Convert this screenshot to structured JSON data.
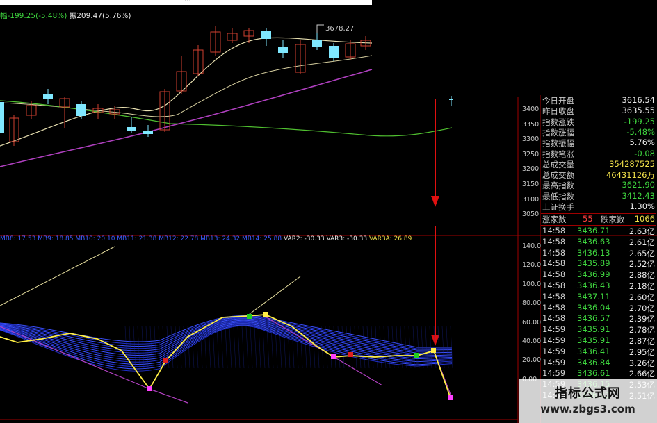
{
  "top_title": "...",
  "info": {
    "change_label": "幅",
    "change_text": "-199.25(-5.48%)",
    "amp_label": "振",
    "amp_text": "209.47(5.76%)"
  },
  "peak_label": "3678.27",
  "price_axis": [
    "3400",
    "3350",
    "3300",
    "3250",
    "3200",
    "3150",
    "3100",
    "3050"
  ],
  "indicator_axis": [
    "140.0",
    "120.0",
    "100.0",
    "80.00",
    "60.00",
    "40.00",
    "20.00",
    "0.00"
  ],
  "indicator_line": {
    "blue_text": "MB8: 17.53  MB9: 18.85  MB10: 20.10  MB11: 21.38  MB12: 22.78  MB13: 24.32  MB14: 25.88",
    "var2": "VAR2: -30.33",
    "var3": "VAR3: -30.33",
    "var3a": "VAR3A: 26.89"
  },
  "summary": [
    {
      "label": "今日开盘",
      "value": "3616.54",
      "color": "#e8e8e8"
    },
    {
      "label": "昨日收盘",
      "value": "3635.55",
      "color": "#e8e8e8"
    },
    {
      "label": "指数涨跌",
      "value": "-199.25",
      "color": "#3fd63f"
    },
    {
      "label": "指数涨幅",
      "value": "-5.48%",
      "color": "#3fd63f"
    },
    {
      "label": "指数振幅",
      "value": "5.76%",
      "color": "#e8e8e8"
    },
    {
      "label": "指数笔涨",
      "value": "-0.08",
      "color": "#3fd63f"
    },
    {
      "label": "总成交量",
      "value": "354287525",
      "color": "#f2e14a"
    },
    {
      "label": "总成交额",
      "value": "46431126万",
      "color": "#f2e14a"
    },
    {
      "label": "最高指数",
      "value": "3621.90",
      "color": "#3fd63f"
    },
    {
      "label": "最低指数",
      "value": "3412.43",
      "color": "#3fd63f"
    },
    {
      "label": "上证换手",
      "value": "1.30%",
      "color": "#e8e8e8"
    }
  ],
  "breadth": {
    "up_label": "涨家数",
    "up_value": "55",
    "down_label": "跌家数",
    "down_value": "1066"
  },
  "ticks": [
    {
      "time": "14:58",
      "price": "3436.71",
      "amount": "2.63亿"
    },
    {
      "time": "14:58",
      "price": "3436.63",
      "amount": "2.61亿"
    },
    {
      "time": "14:58",
      "price": "3436.13",
      "amount": "2.65亿"
    },
    {
      "time": "14:58",
      "price": "3435.89",
      "amount": "2.52亿"
    },
    {
      "time": "14:58",
      "price": "3436.99",
      "amount": "2.88亿"
    },
    {
      "time": "14:58",
      "price": "3436.43",
      "amount": "2.18亿"
    },
    {
      "time": "14:58",
      "price": "3437.11",
      "amount": "2.60亿"
    },
    {
      "time": "14:58",
      "price": "3436.04",
      "amount": "2.70亿"
    },
    {
      "time": "14:58",
      "price": "3436.57",
      "amount": "2.39亿"
    },
    {
      "time": "14:59",
      "price": "3435.91",
      "amount": "2.78亿"
    },
    {
      "time": "14:59",
      "price": "3435.91",
      "amount": "2.87亿"
    },
    {
      "time": "14:59",
      "price": "3436.41",
      "amount": "2.95亿"
    },
    {
      "time": "14:59",
      "price": "3436.84",
      "amount": "3.26亿"
    },
    {
      "time": "14:59",
      "price": "3436.61",
      "amount": "2.66亿"
    },
    {
      "time": "14:59",
      "price": "3436.15",
      "amount": "2.53亿"
    },
    {
      "time": "14:59",
      "price": "3436.43",
      "amount": "2.51亿"
    }
  ],
  "watermark": {
    "title": "指标公式网",
    "url": "www.zbgs3.com"
  },
  "colors": {
    "up": "#d04030",
    "down": "#7fe8ff",
    "ma_short": "#e8e0b0",
    "ma_mid": "#50c030",
    "ma_long": "#b040c0",
    "signal": "#ffee44",
    "grid_red": "#a00000"
  }
}
